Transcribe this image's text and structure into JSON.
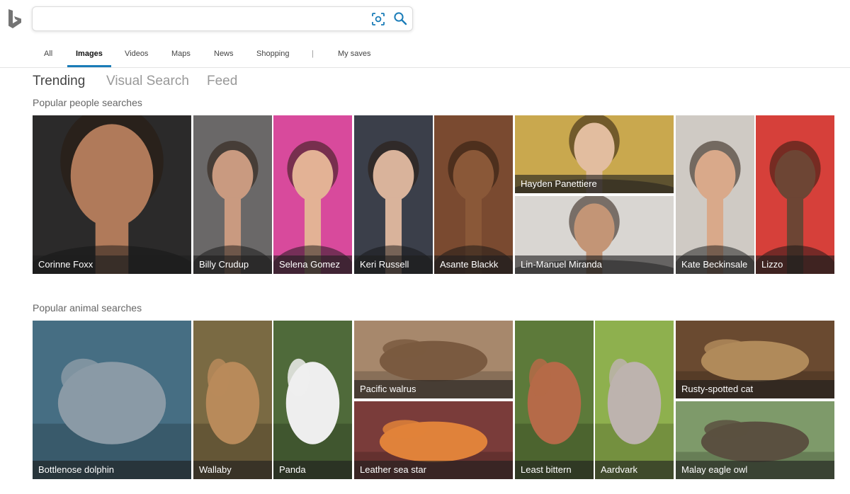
{
  "search": {
    "placeholder": "",
    "value": ""
  },
  "scopes": [
    "All",
    "Images",
    "Videos",
    "Maps",
    "News",
    "Shopping",
    "|",
    "My saves"
  ],
  "active_scope": "Images",
  "subtabs": [
    "Trending",
    "Visual Search",
    "Feed"
  ],
  "active_subtab": "Trending",
  "sections": {
    "people_title": "Popular people searches",
    "animal_title": "Popular animal searches"
  },
  "people": [
    {
      "name": "Corinne Foxx",
      "bg": "#2b2a2a",
      "skin": "#b07a5a"
    },
    {
      "name": "Billy Crudup",
      "bg": "#6a6868",
      "skin": "#c99a80"
    },
    {
      "name": "Selena Gomez",
      "bg": "#d84a9c",
      "skin": "#e3b295"
    },
    {
      "name": "Keri Russell",
      "bg": "#3b3f4a",
      "skin": "#d9b39b"
    },
    {
      "name": "Asante Blackk",
      "bg": "#7a4a30",
      "skin": "#8a5838"
    },
    {
      "name": "Hayden Panettiere",
      "bg": "#c9a84e",
      "skin": "#e2bd9f"
    },
    {
      "name": "Lin-Manuel Miranda",
      "bg": "#d9d6d2",
      "skin": "#c39576"
    },
    {
      "name": "Kate Beckinsale",
      "bg": "#cfcac4",
      "skin": "#d9a98a"
    },
    {
      "name": "Lizzo",
      "bg": "#d6403a",
      "skin": "#6d4534"
    }
  ],
  "animals": [
    {
      "name": "Bottlenose dolphin",
      "bg": "#466e83",
      "fg": "#8a9aa6"
    },
    {
      "name": "Wallaby",
      "bg": "#7a6a43",
      "fg": "#b88a5a"
    },
    {
      "name": "Panda",
      "bg": "#4f6a3a",
      "fg": "#eeeeee"
    },
    {
      "name": "Pacific walrus",
      "bg": "#a7886c",
      "fg": "#7a5a40"
    },
    {
      "name": "Leather sea star",
      "bg": "#7a3c3a",
      "fg": "#e0823a"
    },
    {
      "name": "Least bittern",
      "bg": "#5d7a3a",
      "fg": "#b56a48"
    },
    {
      "name": "Aardvark",
      "bg": "#8eb04e",
      "fg": "#bdb3ae"
    },
    {
      "name": "Rusty-spotted cat",
      "bg": "#6a4a30",
      "fg": "#b08a5a"
    },
    {
      "name": "Malay eagle owl",
      "bg": "#7e9a6a",
      "fg": "#5a5040"
    }
  ]
}
